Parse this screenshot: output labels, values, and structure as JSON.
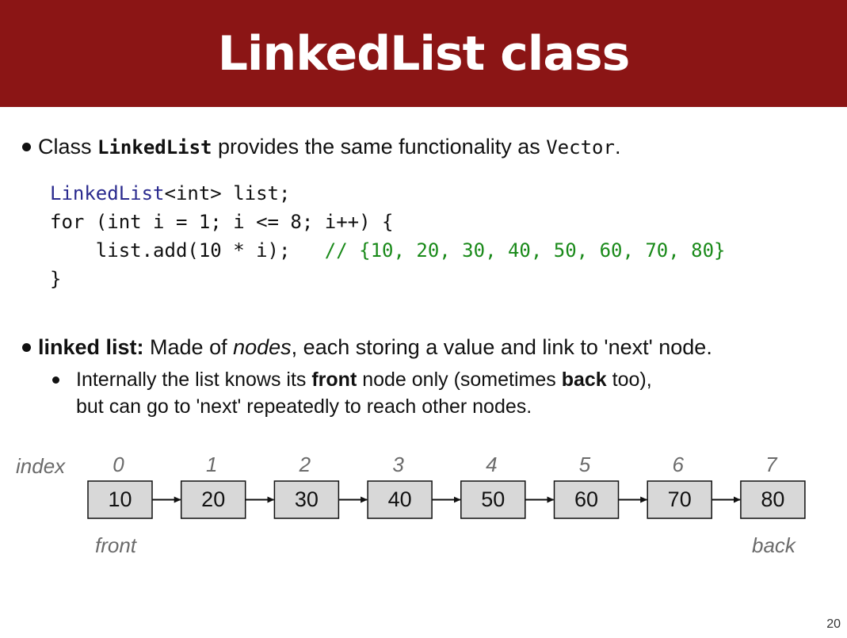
{
  "title": "LinkedList class",
  "bullet1": {
    "pre": "Class ",
    "class_name": "LinkedList",
    "mid": " provides the same functionality as ",
    "other": "Vector",
    "end": "."
  },
  "code": {
    "line1_class": "LinkedList",
    "line1_rest": "<int> list;",
    "line2": "for (int i = 1; i <= 8; i++) {",
    "line3_code": "    list.add(10 * i);   ",
    "line3_comment": "// {10, 20, 30, 40, 50, 60, 70, 80}",
    "line4": "}"
  },
  "bullet2": {
    "term": "linked list:",
    "pre": " Made of ",
    "em": "nodes",
    "post": ", each storing a value and link to 'next' node."
  },
  "sub_bullet": {
    "line1_pre": "Internally the list knows its ",
    "front": "front",
    "line1_mid": " node only (sometimes ",
    "back": "back",
    "line1_end": " too),",
    "line2": "but can go to 'next' repeatedly to reach other nodes."
  },
  "diagram": {
    "index_label": "index",
    "indices": [
      "0",
      "1",
      "2",
      "3",
      "4",
      "5",
      "6",
      "7"
    ],
    "values": [
      "10",
      "20",
      "30",
      "40",
      "50",
      "60",
      "70",
      "80"
    ],
    "front_label": "front",
    "back_label": "back",
    "node_fill": "#d8d8d8"
  },
  "page_number": "20"
}
